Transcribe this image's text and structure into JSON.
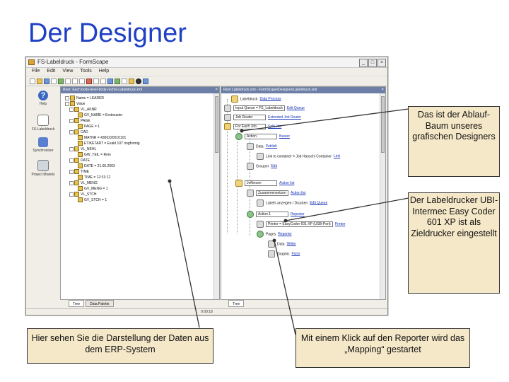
{
  "slide": {
    "title": "Der Designer"
  },
  "window": {
    "title": "FS-Labeldruck - FormScape",
    "menu": [
      "File",
      "Edit",
      "View",
      "Tools",
      "Help"
    ],
    "status": "0:00:18"
  },
  "iconbar": {
    "help": "Help",
    "labeldruck": "FS-Labeldruck",
    "synchronizer": "Synchronizer",
    "project_models": "Project Models"
  },
  "left_pane": {
    "header": "Root: Each body-level-body-rechts-Labeldruck.xml",
    "nodes": [
      "Name = LEADER",
      "Value",
      "VL_AKNR",
      "GV_NAME = Erstmuster",
      "PAGE",
      "PAGE = 1",
      "CAD",
      "MATNR = 4360220010101",
      "ETIKETART = Exakt 107 ringformig",
      "VL_NEHL",
      "GW_TEIL = Rein",
      "DATE",
      "DATE = 21.05.2003",
      "TIME",
      "TIME = 12:31:12",
      "VL_MENG",
      "GV_MENG = 1",
      "VL_STCH",
      "GV_STCH = 1"
    ],
    "tabs": [
      "Tree",
      "Data Palette"
    ]
  },
  "right_pane": {
    "header": "Root Labeldruck.xml - FormScape/Designer/Labeldruck.xml",
    "nodes": [
      {
        "label": "Labeldruck",
        "link": "Data Process"
      },
      {
        "label": "Input Queue = FS_Labeldruck",
        "link": "Edit Queue"
      },
      {
        "label": "Job Router",
        "link": "Extended Job Router"
      },
      {
        "label": "For Each Job",
        "link": "Split Job"
      },
      {
        "label": "Action",
        "link": "Bearer"
      },
      {
        "label": "Data",
        "link": "Publish"
      },
      {
        "label": "Link to container = Job Hanschi Container",
        "link": "Link"
      },
      {
        "label": "Grouper",
        "link": "Edit"
      },
      {
        "label": "Jefferson",
        "link": "Action list"
      },
      {
        "label": "Zusammensetzen",
        "link": "Action list"
      },
      {
        "label": "Labels anzeigen / Drucken",
        "link": "Edit Queue"
      },
      {
        "label": "Action 1",
        "link": "Reporter"
      },
      {
        "label": "Printer = EasyCoder 601 XP (USB-Port)",
        "link": "Printer"
      },
      {
        "label": "Pages",
        "link": "Reporter"
      },
      {
        "label": "Data",
        "link": "Writer"
      },
      {
        "label": "Graphic",
        "link": "Form"
      }
    ],
    "tabs": [
      "Tree"
    ]
  },
  "callouts": {
    "c1": "Das ist der Ablauf-Baum unseres grafischen Designers",
    "c2": "Der Labeldrucker UBI-Intermec Easy Coder 601 XP ist als Zieldrucker eingestellt",
    "c3": "Hier sehen Sie die Darstellung der Daten aus dem ERP-System",
    "c4": "Mit einem Klick auf den Reporter wird das „Mapping“ gestartet"
  },
  "colors": {
    "title": "#1f3fc4",
    "callout_bg": "#f5e8c8",
    "pane_header": "#6d7fa6",
    "link": "#1733b8"
  }
}
